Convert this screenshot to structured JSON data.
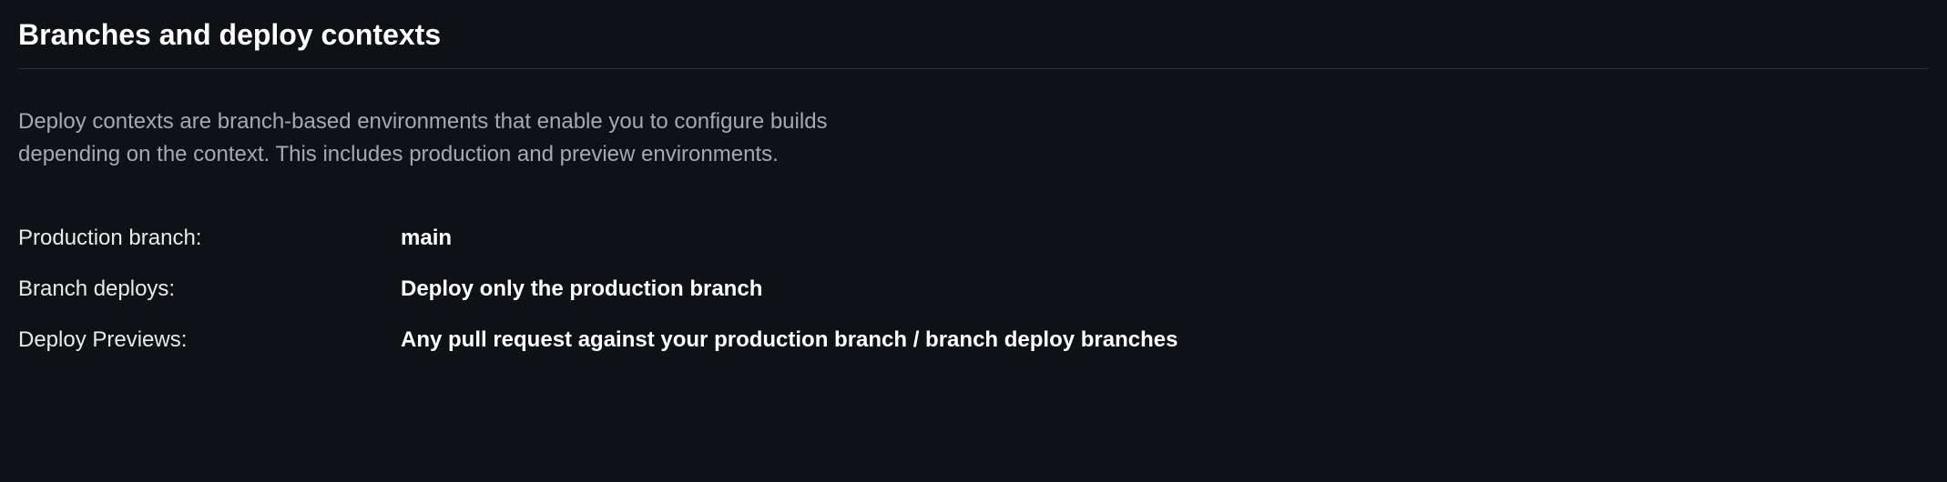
{
  "section": {
    "title": "Branches and deploy contexts",
    "description": "Deploy contexts are branch-based environments that enable you to configure builds depending on the context. This includes production and preview environments."
  },
  "settings": {
    "production_branch": {
      "label": "Production branch:",
      "value": "main"
    },
    "branch_deploys": {
      "label": "Branch deploys:",
      "value": "Deploy only the production branch"
    },
    "deploy_previews": {
      "label": "Deploy Previews:",
      "value": "Any pull request against your production branch / branch deploy branches"
    }
  }
}
